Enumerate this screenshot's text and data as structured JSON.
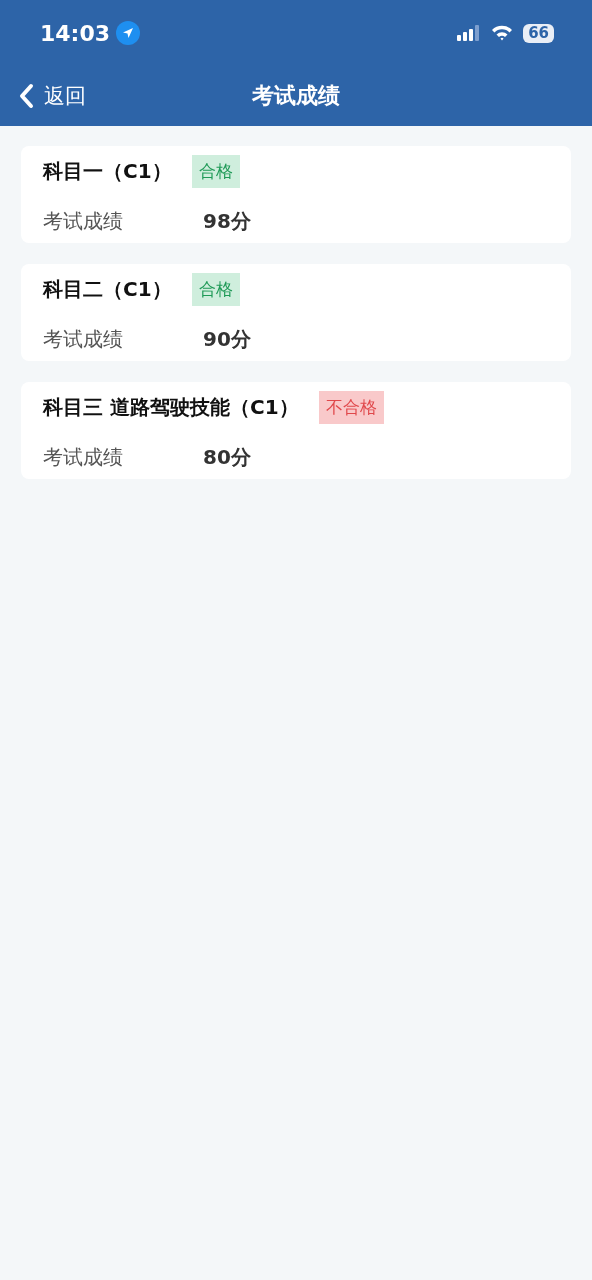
{
  "status_bar": {
    "time": "14:03",
    "battery": "66"
  },
  "nav": {
    "back": "返回",
    "title": "考试成绩"
  },
  "results": [
    {
      "subject": "科目一（C1）",
      "passed": true,
      "badge": "合格",
      "label": "考试成绩",
      "score": "98分"
    },
    {
      "subject": "科目二（C1）",
      "passed": true,
      "badge": "合格",
      "label": "考试成绩",
      "score": "90分"
    },
    {
      "subject": "科目三 道路驾驶技能（C1）",
      "passed": false,
      "badge": "不合格",
      "label": "考试成绩",
      "score": "80分"
    }
  ]
}
